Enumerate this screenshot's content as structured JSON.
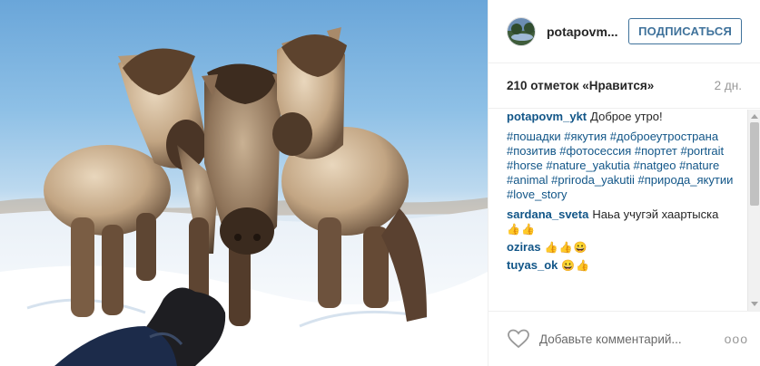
{
  "post": {
    "image_alt": "Yakut horses in snow",
    "author": "potapovm...",
    "follow_label": "ПОДПИСАТЬСЯ",
    "likes_text": "210 отметок «Нравится»",
    "time_text": "2 дн."
  },
  "caption": {
    "author": "potapovm_ykt",
    "text": "Доброе утро!",
    "hashtags": "#пошадки #якутия #доброеутространа #позитив #фотосессия #портет #portrait #horse #nature_yakutia #natgeo #nature #animal #priroda_yakutii #природа_якутии #love_story"
  },
  "comments": [
    {
      "author": "sardana_sveta",
      "text": "Наьа учугэй хаартыска",
      "emoji": "👍👍"
    },
    {
      "author": "oziras",
      "text": "",
      "emoji": "👍👍😀"
    },
    {
      "author": "tuyas_ok",
      "text": "",
      "emoji": "😀👍"
    }
  ],
  "footer": {
    "comment_placeholder": "Добавьте комментарий...",
    "more_label": "ooo"
  },
  "icons": {
    "like": "heart-icon",
    "more": "ellipsis-icon"
  },
  "colors": {
    "link": "#125688",
    "follow": "#3f729b"
  }
}
